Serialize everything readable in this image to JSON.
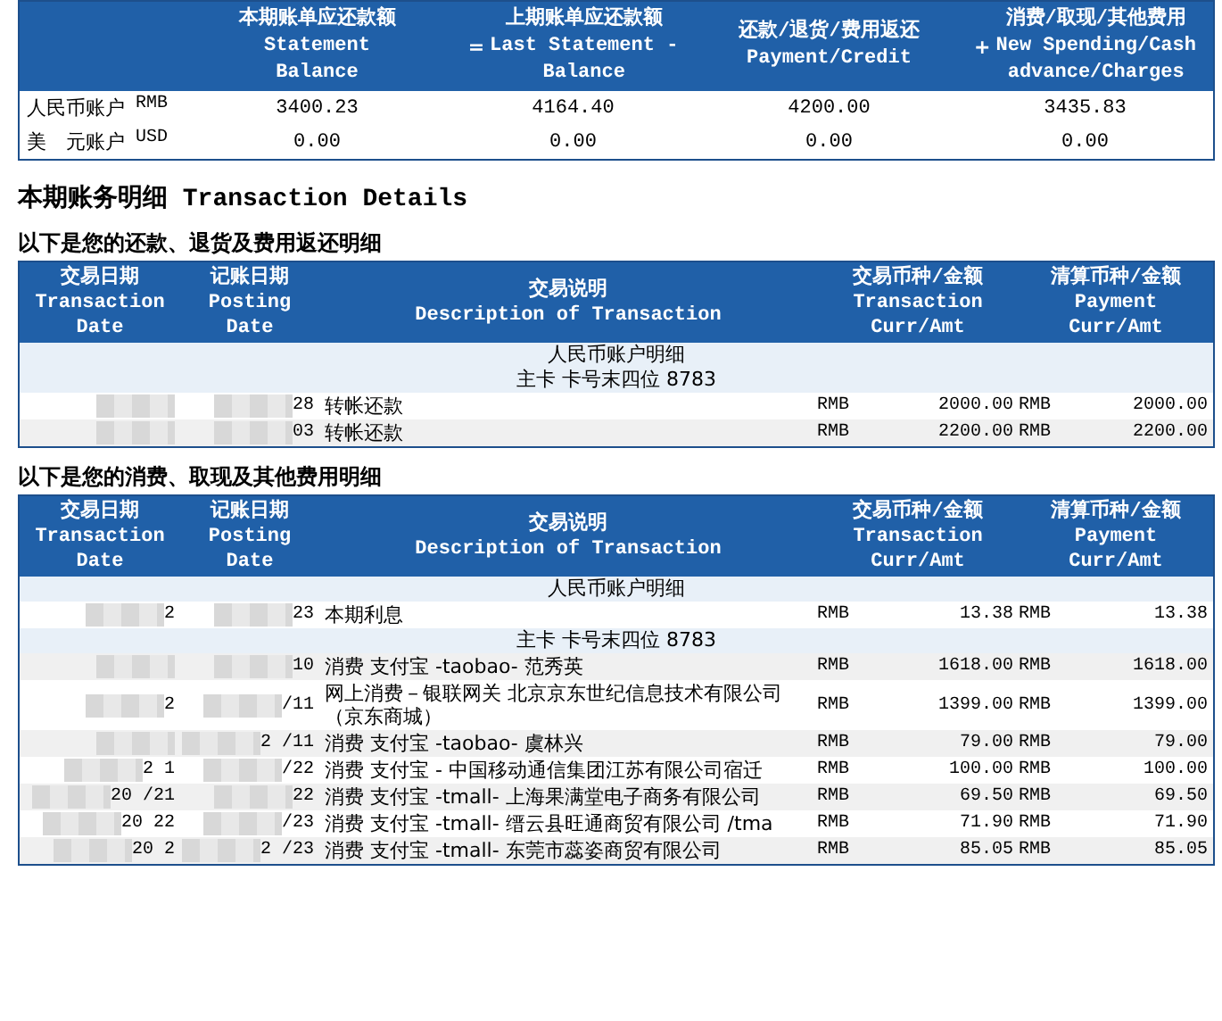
{
  "summary": {
    "columns": [
      {
        "lines": [
          "本期账单应还款额",
          "Statement",
          "Balance"
        ]
      },
      {
        "prefix": "=",
        "lines": [
          "上期账单应还款额",
          "Last Statement -",
          "Balance"
        ]
      },
      {
        "lines": [
          "还款/退货/费用返还",
          "Payment/Credit"
        ]
      },
      {
        "prefix": "+",
        "lines": [
          "消费/取现/其他费用",
          "New Spending/Cash",
          "advance/Charges"
        ]
      }
    ],
    "rows": [
      {
        "account": "人民币账户",
        "currency": "RMB",
        "values": [
          "3400.23",
          "4164.40",
          "4200.00",
          "3435.83"
        ]
      },
      {
        "account": "美　元账户",
        "currency": "USD",
        "values": [
          "0.00",
          "0.00",
          "0.00",
          "0.00"
        ]
      }
    ]
  },
  "heading": "本期账务明细 Transaction Details",
  "sections": [
    {
      "title": "以下是您的还款、退货及费用返还明细",
      "columns": [
        [
          "交易日期",
          "Transaction",
          "Date"
        ],
        [
          "记账日期",
          "Posting",
          "Date"
        ],
        [
          "交易说明",
          "Description of Transaction"
        ],
        [
          "交易币种/金额",
          "Transaction",
          "Curr/Amt"
        ],
        [
          "清算币种/金额",
          "Payment",
          "Curr/Amt"
        ]
      ],
      "rows": [
        {
          "kind": "group",
          "text": "人民币账户明细"
        },
        {
          "kind": "group",
          "text": "主卡 卡号末四位 8783"
        },
        {
          "kind": "txn",
          "posting_date": "28",
          "description": "转帐还款",
          "txn_curr": "RMB",
          "txn_amt": "2000.00",
          "pay_curr": "RMB",
          "pay_amt": "2000.00"
        },
        {
          "kind": "txn",
          "posting_date": "03",
          "description": "转帐还款",
          "txn_curr": "RMB",
          "txn_amt": "2200.00",
          "pay_curr": "RMB",
          "pay_amt": "2200.00"
        }
      ]
    },
    {
      "title": "以下是您的消费、取现及其他费用明细",
      "columns": [
        [
          "交易日期",
          "Transaction",
          "Date"
        ],
        [
          "记账日期",
          "Posting",
          "Date"
        ],
        [
          "交易说明",
          "Description of Transaction"
        ],
        [
          "交易币种/金额",
          "Transaction",
          "Curr/Amt"
        ],
        [
          "清算币种/金额",
          "Payment",
          "Curr/Amt"
        ]
      ],
      "rows": [
        {
          "kind": "group",
          "text": "人民币账户明细"
        },
        {
          "kind": "txn",
          "txn_date": "2",
          "posting_date": "23",
          "description": "本期利息",
          "txn_curr": "RMB",
          "txn_amt": "13.38",
          "pay_curr": "RMB",
          "pay_amt": "13.38"
        },
        {
          "kind": "group",
          "text": "主卡 卡号末四位 8783"
        },
        {
          "kind": "txn",
          "posting_date": "10",
          "description": "消费 支付宝 -taobao- 范秀英",
          "txn_curr": "RMB",
          "txn_amt": "1618.00",
          "pay_curr": "RMB",
          "pay_amt": "1618.00"
        },
        {
          "kind": "txn",
          "txn_date": "2",
          "posting_date": "/11",
          "description": "网上消费－银联网关 北京京东世纪信息技术有限公司（京东商城）",
          "txn_curr": "RMB",
          "txn_amt": "1399.00",
          "pay_curr": "RMB",
          "pay_amt": "1399.00"
        },
        {
          "kind": "txn",
          "posting_date": "2 /11",
          "description": "消费 支付宝 -taobao- 虞林兴",
          "txn_curr": "RMB",
          "txn_amt": "79.00",
          "pay_curr": "RMB",
          "pay_amt": "79.00"
        },
        {
          "kind": "txn",
          "txn_date": "2 1",
          "posting_date": "/22",
          "description": "消费 支付宝 - 中国移动通信集团江苏有限公司宿迁",
          "txn_curr": "RMB",
          "txn_amt": "100.00",
          "pay_curr": "RMB",
          "pay_amt": "100.00"
        },
        {
          "kind": "txn",
          "txn_date": "20 /21",
          "posting_date": "22",
          "description": "消费 支付宝 -tmall- 上海果满堂电子商务有限公司",
          "txn_curr": "RMB",
          "txn_amt": "69.50",
          "pay_curr": "RMB",
          "pay_amt": "69.50"
        },
        {
          "kind": "txn",
          "txn_date": "20 22",
          "posting_date": "/23",
          "description": "消费 支付宝 -tmall- 缙云县旺通商贸有限公司 /tma",
          "txn_curr": "RMB",
          "txn_amt": "71.90",
          "pay_curr": "RMB",
          "pay_amt": "71.90"
        },
        {
          "kind": "txn",
          "txn_date": "20 2",
          "posting_date": "2 /23",
          "description": "消费 支付宝 -tmall- 东莞市蕊姿商贸有限公司",
          "txn_curr": "RMB",
          "txn_amt": "85.05",
          "pay_curr": "RMB",
          "pay_amt": "85.05"
        }
      ]
    }
  ]
}
